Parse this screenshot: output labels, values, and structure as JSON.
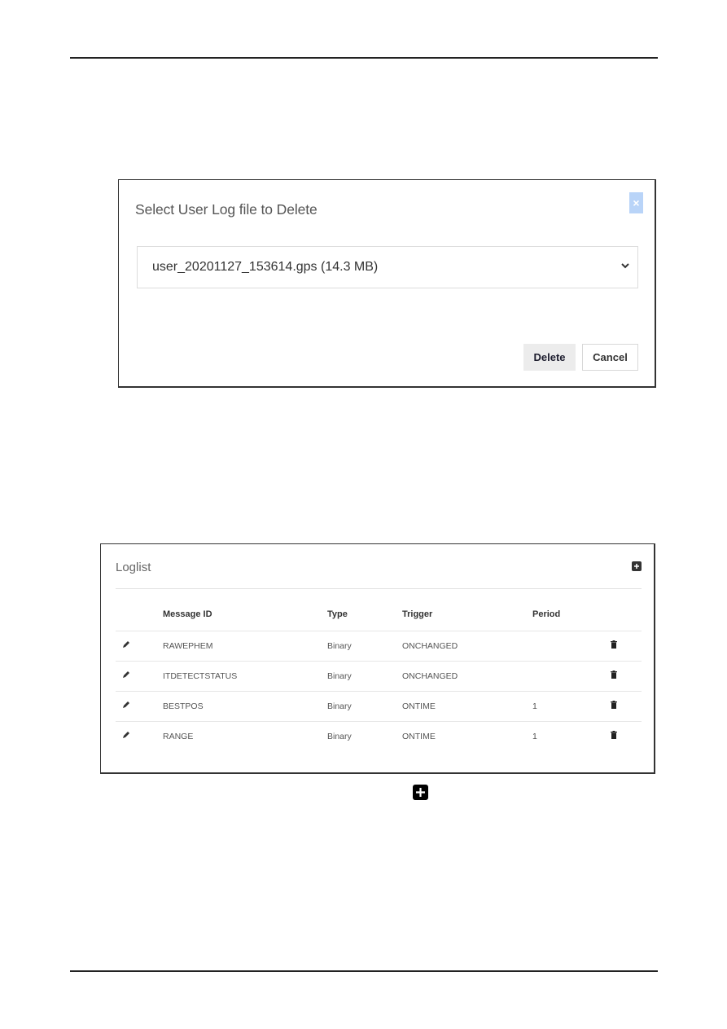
{
  "dialog": {
    "title": "Select User Log file to Delete",
    "close_label": "×",
    "selected_file": "user_20201127_153614.gps (14.3 MB)",
    "delete_label": "Delete",
    "cancel_label": "Cancel",
    "close_button_color": "#b9d4f8"
  },
  "loglist": {
    "title": "Loglist",
    "columns": [
      "Message ID",
      "Type",
      "Trigger",
      "Period"
    ],
    "rows": [
      {
        "message_id": "RAWEPHEM",
        "type": "Binary",
        "trigger": "ONCHANGED",
        "period": ""
      },
      {
        "message_id": "ITDETECTSTATUS",
        "type": "Binary",
        "trigger": "ONCHANGED",
        "period": ""
      },
      {
        "message_id": "BESTPOS",
        "type": "Binary",
        "trigger": "ONTIME",
        "period": "1"
      },
      {
        "message_id": "RANGE",
        "type": "Binary",
        "trigger": "ONTIME",
        "period": "1"
      }
    ]
  },
  "icons": {
    "add": "plus-square-icon",
    "edit": "pencil-icon",
    "delete": "trash-icon",
    "dropdown": "chevron-down-icon",
    "close": "close-icon"
  }
}
